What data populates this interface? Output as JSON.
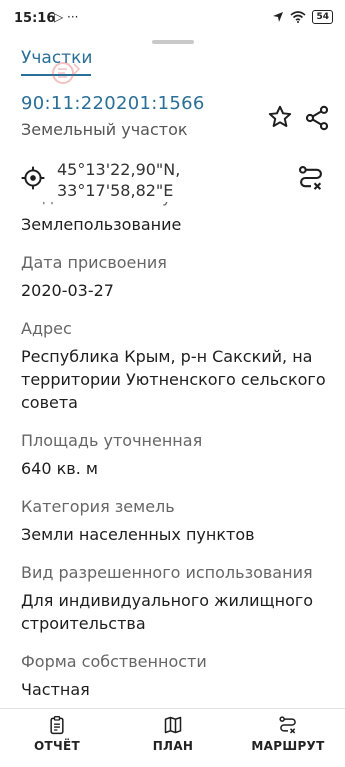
{
  "status_bar": {
    "time": "15:16",
    "left_icons": "▷ ···",
    "battery": "54"
  },
  "header": {
    "tab_label": "Участки"
  },
  "parcel": {
    "cadastral_number": "90:11:220201:1566",
    "object_type": "Земельный участок"
  },
  "coordinates": {
    "latitude": "45°13'22,90\"N,",
    "longitude": "33°17'58,82\"E"
  },
  "fields": [
    {
      "label": "Вид земельного участка",
      "value": "Землепользование"
    },
    {
      "label": "Дата присвоения",
      "value": "2020-03-27"
    },
    {
      "label": "Адрес",
      "value": "Республика Крым, р-н Сакский, на территории Уютненского сельского совета"
    },
    {
      "label": "Площадь уточненная",
      "value": "640 кв. м"
    },
    {
      "label": "Категория земель",
      "value": "Земли населенных пунктов"
    },
    {
      "label": "Вид разрешенного использования",
      "value": "Для индивидуального жилищного строительства"
    },
    {
      "label": "Форма собственности",
      "value": "Частная"
    }
  ],
  "bottom_nav": {
    "report_label": "ОТЧЁТ",
    "plan_label": "ПЛАН",
    "route_label": "МАРШРУТ"
  },
  "colors": {
    "accent": "#2a6f97",
    "text": "#1e1e1e",
    "label": "#666666"
  },
  "icons": [
    "send-icon",
    "location-arrow-icon",
    "wifi-icon",
    "battery-icon",
    "star-icon",
    "share-icon",
    "crosshair-icon",
    "route-icon",
    "report-icon",
    "map-icon"
  ]
}
